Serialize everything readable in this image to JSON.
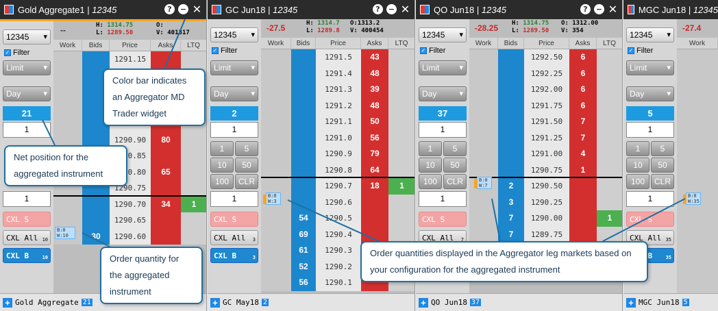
{
  "panels": [
    {
      "title": "Gold Aggregate1 | ",
      "title_account": "12345",
      "account": "12345",
      "filter_label": "Filter",
      "order_type": "Limit",
      "tif": "Day",
      "net_position": "21",
      "qty1": "1",
      "qty2": "1",
      "change": "--",
      "high_label": "H:",
      "high": "1314.75",
      "low_label": "L:",
      "low": "1289.50",
      "open_label": "O:",
      "open": "",
      "volume_label": "V:",
      "volume": "401317",
      "footer_name": "Gold Aggregate",
      "footer_badge": "21",
      "cxl_all_count": "10",
      "cxl_b_count": "10"
    },
    {
      "title": "GC Jun18 | ",
      "title_account": "12345",
      "account": "12345",
      "filter_label": "Filter",
      "order_type": "Limit",
      "tif": "Day",
      "net_position": "2",
      "qty1": "1",
      "qty2": "1",
      "change": "-27.5",
      "high_label": "H:",
      "high": "1314.7",
      "low_label": "L:",
      "low": "1289.8",
      "open_label": "O:",
      "open": "1313.2",
      "volume_label": "V:",
      "volume": "400454",
      "footer_name": "GC May18",
      "footer_badge": "2",
      "cxl_all_count": "3",
      "cxl_b_count": "3"
    },
    {
      "title": "QO Jun18 | ",
      "title_account": "12345",
      "account": "12345",
      "filter_label": "Filter",
      "order_type": "Limit",
      "tif": "Day",
      "net_position": "37",
      "qty1": "1",
      "qty2": "1",
      "change": "-28.25",
      "high_label": "H:",
      "high": "1314.75",
      "low_label": "L:",
      "low": "1289.50",
      "open_label": "O:",
      "open": "1312.00",
      "volume_label": "V:",
      "volume": "354",
      "footer_name": "QO Jun18",
      "footer_badge": "37",
      "cxl_all_count": "7",
      "cxl_b_count": "7"
    },
    {
      "title": "MGC Jun18 | ",
      "title_account": "12345",
      "account": "12345",
      "filter_label": "Filter",
      "order_type": "Limit",
      "tif": "Day",
      "net_position": "5",
      "qty1": "1",
      "qty2": "1",
      "change": "-27.4",
      "footer_name": "MGC Jun18",
      "footer_badge": "5",
      "cxl_all_count": "35",
      "cxl_b_count": "35"
    }
  ],
  "columns": [
    "Work",
    "Bids",
    "Price",
    "Asks",
    "LTQ"
  ],
  "buttons": {
    "one": "1",
    "five": "5",
    "ten": "10",
    "fifty": "50",
    "hundred": "100",
    "clr": "CLR",
    "cxl_s": "CXL S",
    "cxl_all": "CXL All",
    "cxl_b": "CXL B"
  },
  "ladder1": [
    {
      "p": "1291.15",
      "a": "",
      "b": "",
      "l": ""
    },
    {
      "p": "",
      "a": "",
      "b": "",
      "l": ""
    },
    {
      "p": "",
      "a": "",
      "b": "",
      "l": ""
    },
    {
      "p": "",
      "a": "",
      "b": "",
      "l": ""
    },
    {
      "p": "",
      "a": "",
      "b": "",
      "l": ""
    },
    {
      "p": "1290.90",
      "a": "80",
      "b": "",
      "l": ""
    },
    {
      "p": "1290.85",
      "a": "",
      "b": "",
      "l": ""
    },
    {
      "p": "1290.80",
      "a": "65",
      "b": "",
      "l": ""
    },
    {
      "p": "1290.75",
      "a": "",
      "b": "",
      "l": ""
    },
    {
      "p": "1290.70",
      "a": "34",
      "b": "",
      "l": "1"
    },
    {
      "p": "1290.65",
      "a": "",
      "b": "",
      "l": ""
    },
    {
      "p": "1290.60",
      "a": "",
      "b": "30",
      "l": ""
    }
  ],
  "ladder2": [
    {
      "p": "1291.5",
      "a": "43",
      "b": "",
      "l": ""
    },
    {
      "p": "1291.4",
      "a": "48",
      "b": "",
      "l": ""
    },
    {
      "p": "1291.3",
      "a": "39",
      "b": "",
      "l": ""
    },
    {
      "p": "1291.2",
      "a": "48",
      "b": "",
      "l": ""
    },
    {
      "p": "1291.1",
      "a": "50",
      "b": "",
      "l": ""
    },
    {
      "p": "1291.0",
      "a": "56",
      "b": "",
      "l": ""
    },
    {
      "p": "1290.9",
      "a": "79",
      "b": "",
      "l": ""
    },
    {
      "p": "1290.8",
      "a": "64",
      "b": "",
      "l": ""
    },
    {
      "p": "1290.7",
      "a": "18",
      "b": "",
      "l": "1"
    },
    {
      "p": "1290.6",
      "a": "",
      "b": "",
      "l": ""
    },
    {
      "p": "1290.5",
      "a": "",
      "b": "54",
      "l": ""
    },
    {
      "p": "1290.4",
      "a": "",
      "b": "69",
      "l": ""
    },
    {
      "p": "1290.3",
      "a": "",
      "b": "61",
      "l": ""
    },
    {
      "p": "1290.2",
      "a": "",
      "b": "52",
      "l": ""
    },
    {
      "p": "1290.1",
      "a": "",
      "b": "56",
      "l": ""
    }
  ],
  "ladder3": [
    {
      "p": "1292.50",
      "a": "6",
      "b": "",
      "l": ""
    },
    {
      "p": "1292.25",
      "a": "6",
      "b": "",
      "l": ""
    },
    {
      "p": "1292.00",
      "a": "6",
      "b": "",
      "l": ""
    },
    {
      "p": "1291.75",
      "a": "6",
      "b": "",
      "l": ""
    },
    {
      "p": "1291.50",
      "a": "7",
      "b": "",
      "l": ""
    },
    {
      "p": "1291.25",
      "a": "7",
      "b": "",
      "l": ""
    },
    {
      "p": "1291.00",
      "a": "4",
      "b": "",
      "l": ""
    },
    {
      "p": "1290.75",
      "a": "1",
      "b": "",
      "l": ""
    },
    {
      "p": "1290.50",
      "a": "",
      "b": "2",
      "l": ""
    },
    {
      "p": "1290.25",
      "a": "",
      "b": "3",
      "l": ""
    },
    {
      "p": "1290.00",
      "a": "",
      "b": "7",
      "l": "1"
    },
    {
      "p": "1289.75",
      "a": "",
      "b": "7",
      "l": ""
    }
  ],
  "orders": {
    "agg": "B:0\nW:10",
    "gc": "B:0\nW:3",
    "qo": "B:0\nW:7",
    "mgc": "B:0\nW:35"
  },
  "callouts": {
    "color_bar": "Color bar indicates an Aggregator MD Trader widget",
    "net_position": "Net position for the aggregated instrument",
    "order_qty": "Order quantity for the aggregated instrument",
    "leg_orders": "Order quantities displayed in the Aggregator leg markets based on your configuration for the aggregated instrument"
  }
}
